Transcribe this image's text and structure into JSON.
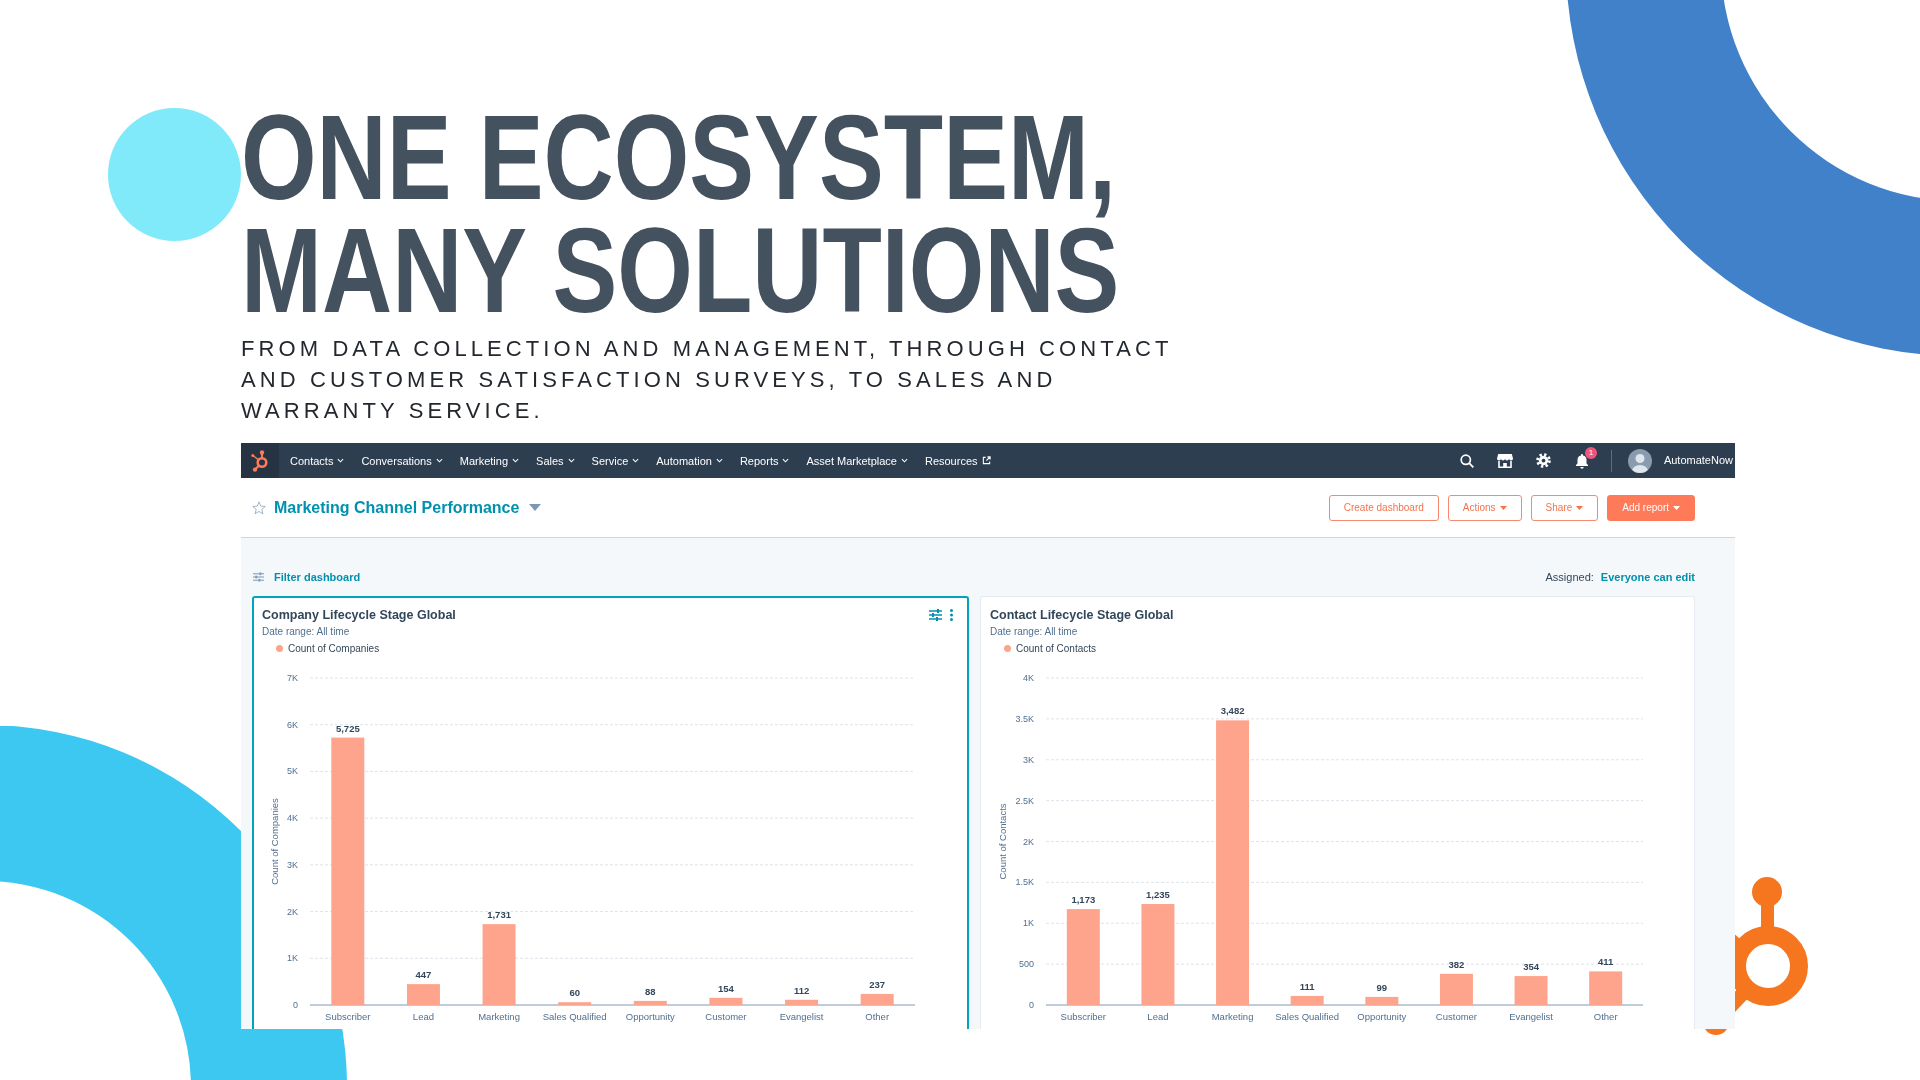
{
  "slide": {
    "headline": "ONE ECOSYSTEM, MANY SOLUTIONS",
    "subheading": "FROM DATA COLLECTION AND MANAGEMENT, THROUGH CONTACT AND CUSTOMER SATISFACTION SURVEYS, TO SALES AND WARRANTY SERVICE."
  },
  "navbar": {
    "items": [
      {
        "label": "Contacts",
        "kind": "dropdown"
      },
      {
        "label": "Conversations",
        "kind": "dropdown"
      },
      {
        "label": "Marketing",
        "kind": "dropdown"
      },
      {
        "label": "Sales",
        "kind": "dropdown"
      },
      {
        "label": "Service",
        "kind": "dropdown"
      },
      {
        "label": "Automation",
        "kind": "dropdown"
      },
      {
        "label": "Reports",
        "kind": "dropdown"
      },
      {
        "label": "Asset Marketplace",
        "kind": "dropdown"
      },
      {
        "label": "Resources",
        "kind": "external"
      }
    ],
    "notification_count": "1",
    "account_name": "AutomateNow"
  },
  "dashboard": {
    "title": "Marketing Channel Performance",
    "starred": false,
    "buttons": [
      {
        "label": "Create dashboard",
        "kind": "outline",
        "dropdown": false
      },
      {
        "label": "Actions",
        "kind": "outline",
        "dropdown": true
      },
      {
        "label": "Share",
        "kind": "outline",
        "dropdown": true
      },
      {
        "label": "Add report",
        "kind": "primary",
        "dropdown": true
      }
    ],
    "filter_label": "Filter dashboard",
    "assigned_label": "Assigned:",
    "assigned_value": "Everyone can edit"
  },
  "cards": [
    {
      "title": "Company Lifecycle Stage Global",
      "selected": true,
      "date_range": "Date range: All time",
      "chart_data": {
        "type": "bar",
        "ylabel": "Count of Companies",
        "categories": [
          "Subscriber",
          "Lead",
          "Marketing",
          "Sales Qualified",
          "Opportunity",
          "Customer",
          "Evangelist",
          "Other"
        ],
        "series": [
          {
            "name": "Count of Companies",
            "color": "#fea48c",
            "values": [
              5725,
              447,
              1731,
              60,
              88,
              154,
              112,
              237
            ]
          }
        ],
        "ylim": [
          0,
          7000
        ],
        "yticks": [
          {
            "value": 0,
            "label": "0"
          },
          {
            "value": 1000,
            "label": "1K"
          },
          {
            "value": 2000,
            "label": "2K"
          },
          {
            "value": 3000,
            "label": "3K"
          },
          {
            "value": 4000,
            "label": "4K"
          },
          {
            "value": 5000,
            "label": "5K"
          },
          {
            "value": 6000,
            "label": "6K"
          },
          {
            "value": 7000,
            "label": "7K"
          }
        ],
        "grid": true,
        "value_labels": [
          "5,725",
          "447",
          "1,731",
          "60",
          "88",
          "154",
          "112",
          "237"
        ]
      }
    },
    {
      "title": "Contact Lifecycle Stage Global",
      "selected": false,
      "date_range": "Date range: All time",
      "chart_data": {
        "type": "bar",
        "ylabel": "Count of Contacts",
        "categories": [
          "Subscriber",
          "Lead",
          "Marketing",
          "Sales Qualified",
          "Opportunity",
          "Customer",
          "Evangelist",
          "Other"
        ],
        "series": [
          {
            "name": "Count of Contacts",
            "color": "#fea48c",
            "values": [
              1173,
              1235,
              3482,
              111,
              99,
              382,
              354,
              411
            ]
          }
        ],
        "ylim": [
          0,
          4000
        ],
        "yticks": [
          {
            "value": 0,
            "label": "0"
          },
          {
            "value": 500,
            "label": "500"
          },
          {
            "value": 1000,
            "label": "1K"
          },
          {
            "value": 1500,
            "label": "1.5K"
          },
          {
            "value": 2000,
            "label": "2K"
          },
          {
            "value": 2500,
            "label": "2.5K"
          },
          {
            "value": 3000,
            "label": "3K"
          },
          {
            "value": 3500,
            "label": "3.5K"
          },
          {
            "value": 4000,
            "label": "4K"
          }
        ],
        "grid": true,
        "value_labels": [
          "1,173",
          "1,235",
          "3,482",
          "111",
          "99",
          "382",
          "354",
          "411"
        ]
      }
    }
  ]
}
